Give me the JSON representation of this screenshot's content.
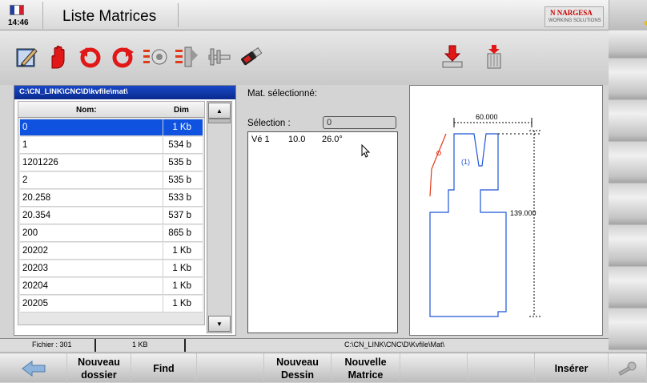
{
  "header": {
    "time": "14:46",
    "title": "Liste Matrices",
    "flag_colors": [
      "#1f3ea6",
      "#ffffff",
      "#d21e2a"
    ],
    "logo_name": "N NARGESA",
    "logo_tagline": "WORKING SOLUTIONS"
  },
  "toolbar": {
    "icons": [
      "pencil-edit-icon",
      "stop-hand-icon",
      "rotate-left-icon",
      "rotate-right-icon",
      "toggle-left-icon",
      "toggle-right-icon",
      "caliper-icon",
      "usb-drive-icon",
      "import-disk-icon",
      "delete-bin-icon"
    ]
  },
  "filelist": {
    "path": "C:\\CN_LINK\\CNC\\D\\kvfile\\mat\\",
    "col_name": "Nom:",
    "col_dim": "Dim",
    "rows": [
      {
        "name": "0",
        "size": "1 Kb",
        "selected": true
      },
      {
        "name": "1",
        "size": "534  b"
      },
      {
        "name": "1201226",
        "size": "535  b"
      },
      {
        "name": "2",
        "size": "535  b"
      },
      {
        "name": "20.258",
        "size": "533  b"
      },
      {
        "name": "20.354",
        "size": "537  b"
      },
      {
        "name": "200",
        "size": "865  b"
      },
      {
        "name": "20202",
        "size": "1 Kb"
      },
      {
        "name": "20203",
        "size": "1 Kb"
      },
      {
        "name": "20204",
        "size": "1 Kb"
      },
      {
        "name": "20205",
        "size": "1 Kb"
      }
    ]
  },
  "selection": {
    "title": "Mat. sélectionné:",
    "label": "Sélection :",
    "value": "0",
    "line_type": "Vé 1",
    "line_dim": "10.0",
    "line_angle": "26.0°"
  },
  "drawing": {
    "width_label": "60.000",
    "height_label": "139.000",
    "vee_label": "(1)",
    "outline_color": "#1f55d8",
    "tool_color": "#e23a1a"
  },
  "statusbar": {
    "files": "Fichier : 301",
    "size": "1 KB",
    "path": "C:\\CN_LINK\\CNC\\D\\Kvfile\\Mat\\"
  },
  "fkeys": {
    "back": "back-arrow-icon",
    "new_folder_1": "Nouveau",
    "new_folder_2": "dossier",
    "find": "Find",
    "new_drawing_1": "Nouveau",
    "new_drawing_2": "Dessin",
    "new_matrix_1": "Nouvelle",
    "new_matrix_2": "Matrice",
    "insert": "Insérer",
    "settings": "wrench-settings-icon"
  }
}
